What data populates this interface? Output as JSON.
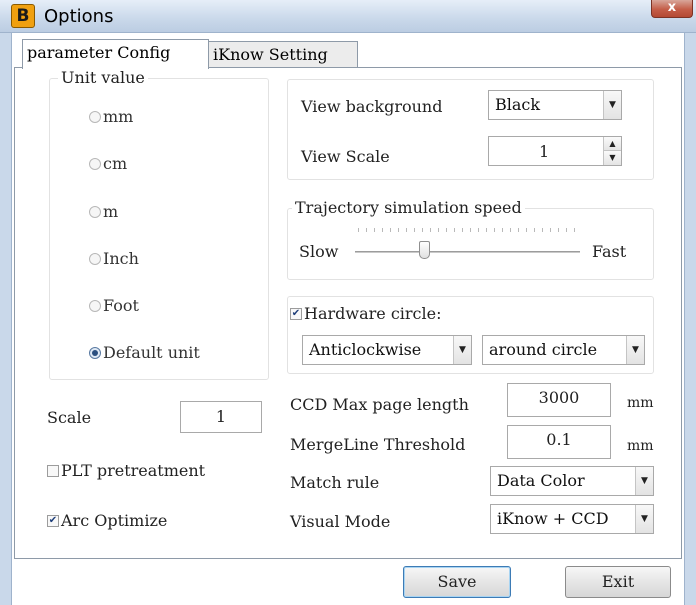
{
  "window": {
    "title": "Options",
    "icon_letter": "B",
    "close_label": "x"
  },
  "tabs": [
    {
      "label": "parameter Config",
      "active": true
    },
    {
      "label": "iKnow Setting",
      "active": false
    }
  ],
  "unit_group": {
    "legend": "Unit value",
    "options": [
      {
        "label": "mm",
        "checked": false
      },
      {
        "label": "cm",
        "checked": false
      },
      {
        "label": "m",
        "checked": false
      },
      {
        "label": "Inch",
        "checked": false
      },
      {
        "label": "Foot",
        "checked": false
      },
      {
        "label": "Default unit",
        "checked": true
      }
    ]
  },
  "view": {
    "background_label": "View background",
    "background_value": "Black",
    "scale_label": "View Scale",
    "scale_value": "1"
  },
  "trajectory": {
    "legend": "Trajectory simulation speed",
    "slow_label": "Slow",
    "fast_label": "Fast",
    "level": 0.31
  },
  "hardware_circle": {
    "label": "Hardware circle:",
    "checked": true,
    "direction_value": "Anticlockwise",
    "mode_value": "around circle"
  },
  "scale": {
    "label": "Scale",
    "value": "1"
  },
  "plt_pretreatment": {
    "label": "PLT pretreatment",
    "checked": false
  },
  "arc_optimize": {
    "label": "Arc Optimize",
    "checked": true
  },
  "ccd": {
    "label": "CCD Max page length",
    "value": "3000",
    "unit": "mm"
  },
  "mergeline": {
    "label": "MergeLine Threshold",
    "value": "0.1",
    "unit": "mm"
  },
  "match_rule": {
    "label": "Match rule",
    "value": "Data Color"
  },
  "visual_mode": {
    "label": "Visual Mode",
    "value": "iKnow + CCD"
  },
  "buttons": {
    "save": "Save",
    "exit": "Exit"
  }
}
